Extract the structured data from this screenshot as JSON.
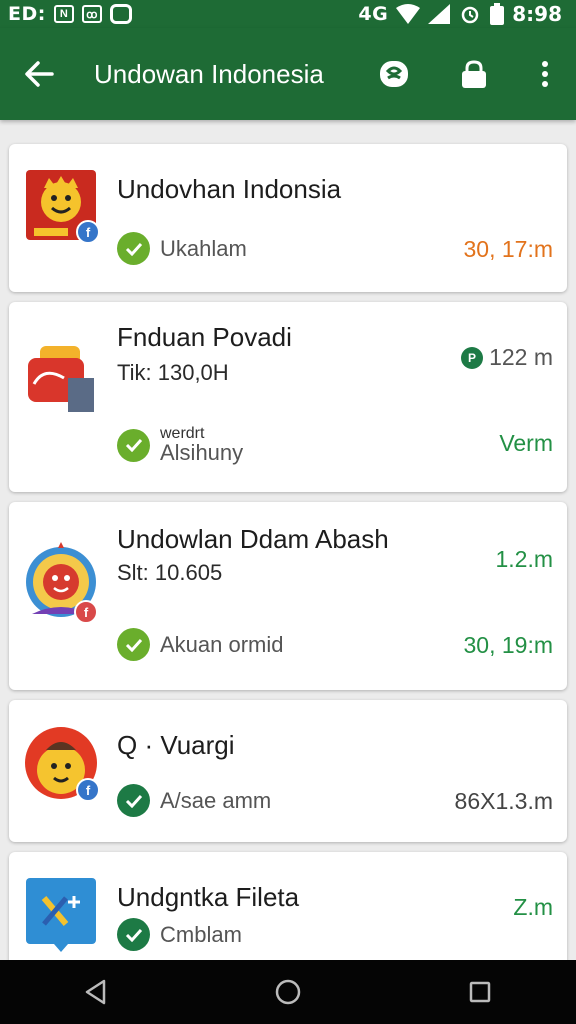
{
  "status_bar": {
    "left_text": "ED:",
    "box1": "N",
    "box2": "ꝏ",
    "network": "4G",
    "time": "8:98"
  },
  "app_bar": {
    "title": "Undowan Indonesia",
    "icons": [
      "back-arrow-icon",
      "translate-icon",
      "lock-icon",
      "more-vert-icon"
    ]
  },
  "colors": {
    "primary": "#1e6b35",
    "accent_orange": "#e2731c",
    "accent_green": "#239045",
    "check_lime": "#6aae2c",
    "check_dark": "#1d7a45"
  },
  "items": [
    {
      "title": "Undovhan Indonsia",
      "status": "Ukahlam",
      "value": "30, 17:m",
      "badge": "f"
    },
    {
      "title": "Fnduan Povadi",
      "subtitle": "Tik: 130,0H",
      "rating": "122 m",
      "rating_icon": "P",
      "status_small": "werdrt",
      "status": "Alsihuny",
      "value": "Verm"
    },
    {
      "title": "Undowlan Ddam Abash",
      "subtitle": "Slt: 10.605",
      "distance": "1.2.m",
      "status": "Akuan ormid",
      "value": "30, 19:m",
      "badge": "f"
    },
    {
      "title": "Q · Vuargi",
      "status": "A/sae amm",
      "value": "86X1.3.m",
      "badge": "f"
    },
    {
      "title": "Undgntka Fileta",
      "status": "Cmblam",
      "value": "Z.m"
    }
  ],
  "nav": [
    "back-triangle-icon",
    "home-circle-icon",
    "recents-square-icon"
  ]
}
